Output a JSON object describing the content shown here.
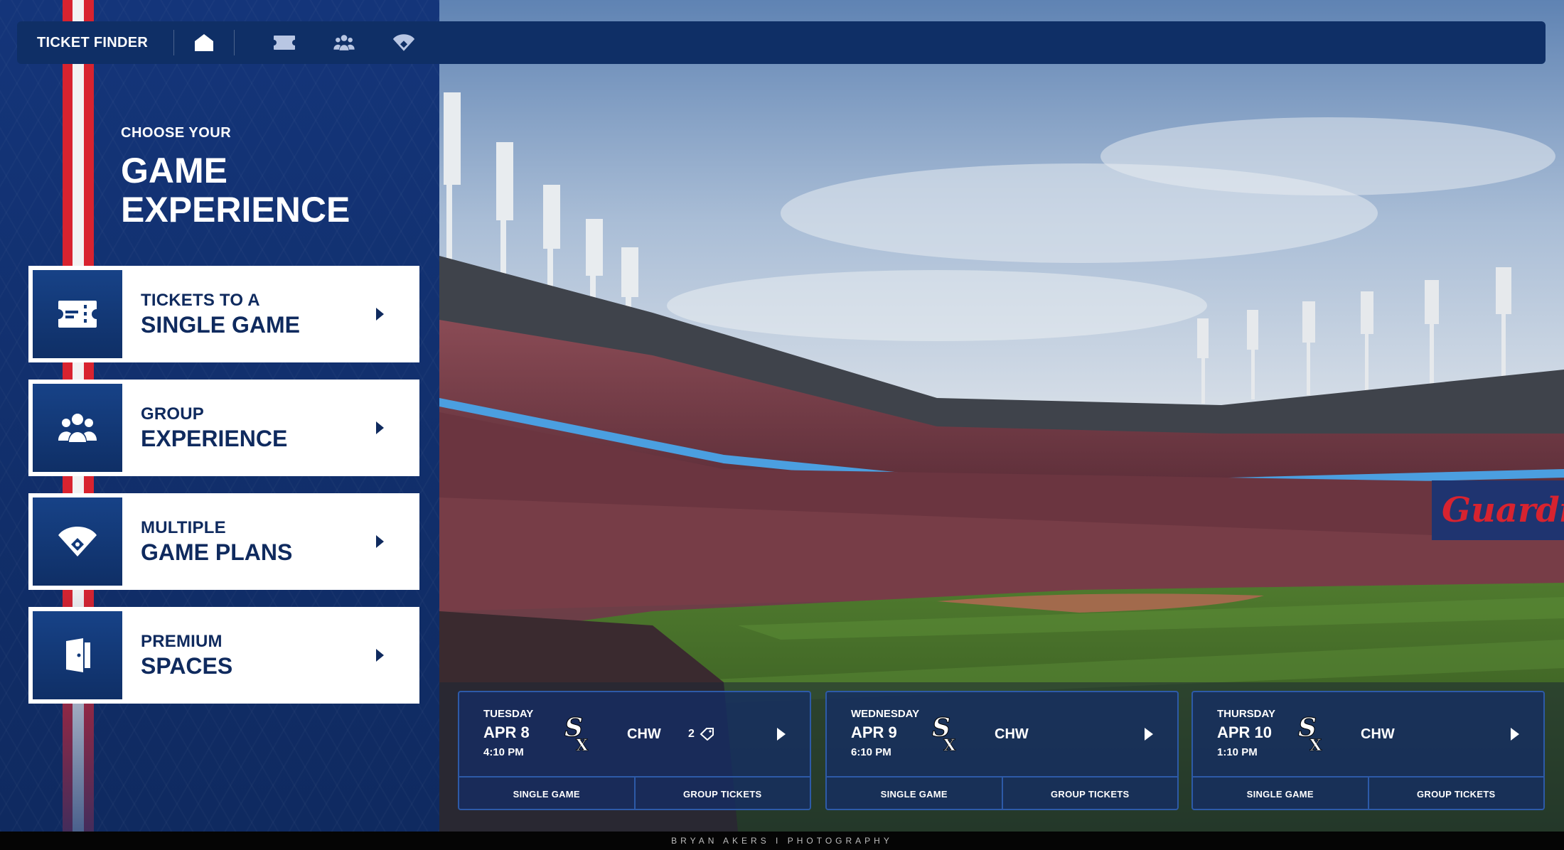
{
  "nav": {
    "title": "TICKET FINDER",
    "icons": [
      "home-icon",
      "ticket-icon",
      "group-icon",
      "baseball-diamond-icon"
    ]
  },
  "heading": {
    "pretitle": "CHOOSE YOUR",
    "title": "GAME EXPERIENCE"
  },
  "options": [
    {
      "line1": "TICKETS TO A",
      "line2": "SINGLE GAME",
      "icon": "ticket-icon"
    },
    {
      "line1": "GROUP",
      "line2": "EXPERIENCE",
      "icon": "group-icon"
    },
    {
      "line1": "MULTIPLE",
      "line2": "GAME PLANS",
      "icon": "baseball-diamond-icon"
    },
    {
      "line1": "PREMIUM",
      "line2": "SPACES",
      "icon": "door-icon"
    }
  ],
  "games": [
    {
      "day": "TUESDAY",
      "date": "APR 8",
      "time": "4:10 PM",
      "team": "CHW",
      "count": "2",
      "single": "SINGLE GAME",
      "group": "GROUP TICKETS"
    },
    {
      "day": "WEDNESDAY",
      "date": "APR 9",
      "time": "6:10 PM",
      "team": "CHW",
      "single": "SINGLE GAME",
      "group": "GROUP TICKETS"
    },
    {
      "day": "THURSDAY",
      "date": "APR 10",
      "time": "1:10 PM",
      "team": "CHW",
      "single": "SINGLE GAME",
      "group": "GROUP TICKETS"
    }
  ],
  "stadium": {
    "banner": "Guardia"
  },
  "credit": "BRYAN AKERS I PHOTOGRAPHY",
  "colors": {
    "navy": "#0f2f66",
    "red": "#d8232f",
    "card_border": "#2d5aa8"
  }
}
